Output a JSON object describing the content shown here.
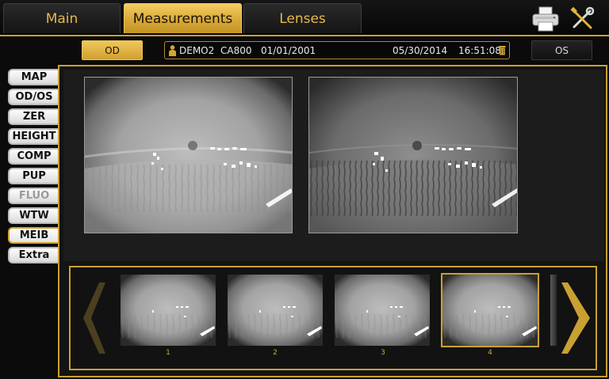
{
  "tabs": [
    {
      "label": "Main",
      "active": false
    },
    {
      "label": "Measurements",
      "active": true
    },
    {
      "label": "Lenses",
      "active": false
    }
  ],
  "toolbar_icons": [
    "printer-icon",
    "tools-icon"
  ],
  "eye_buttons": {
    "od": "OD",
    "os": "OS"
  },
  "patient": {
    "name": "DEMO2",
    "id": "CA800",
    "dob": "01/01/2001",
    "exam_date": "05/30/2014",
    "exam_time": "16:51:08"
  },
  "side_menu": [
    {
      "label": "MAP",
      "state": "normal"
    },
    {
      "label": "OD/OS",
      "state": "normal"
    },
    {
      "label": "ZER",
      "state": "normal"
    },
    {
      "label": "HEIGHT",
      "state": "normal"
    },
    {
      "label": "COMP",
      "state": "normal"
    },
    {
      "label": "PUP",
      "state": "normal"
    },
    {
      "label": "FLUO",
      "state": "disabled"
    },
    {
      "label": "WTW",
      "state": "normal"
    },
    {
      "label": "MEIB",
      "state": "active"
    },
    {
      "label": "Extra",
      "state": "normal"
    }
  ],
  "thumbnails": [
    {
      "label": "1",
      "selected": false
    },
    {
      "label": "2",
      "selected": false
    },
    {
      "label": "3",
      "selected": false
    },
    {
      "label": "4",
      "selected": true
    }
  ],
  "colors": {
    "accent": "#c9a032",
    "tab_active": "#e0b241",
    "tab_text": "#e7b84a"
  }
}
